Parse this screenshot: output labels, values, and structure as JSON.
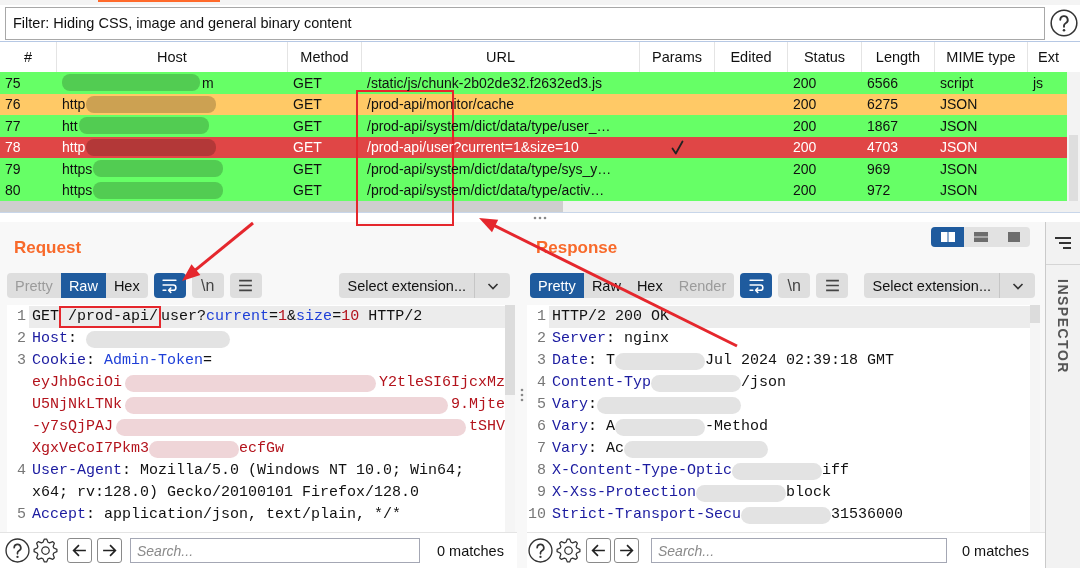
{
  "filter_bar": {
    "text": "Filter: Hiding CSS, image and general binary content"
  },
  "table": {
    "columns": [
      "#",
      "Host",
      "Method",
      "URL",
      "Params",
      "Edited",
      "Status",
      "Length",
      "MIME type",
      "Ext"
    ],
    "rows": [
      {
        "number": "75",
        "host": "m",
        "redacted_before": true,
        "redacted_after": false,
        "method": "GET",
        "url": "/static/js/chunk-2b02de32.f2632ed3.js",
        "params": false,
        "status": "200",
        "length": "6566",
        "mime": "script",
        "extension": "js",
        "color": "#66ff66"
      },
      {
        "number": "76",
        "host": "http",
        "redacted_before": false,
        "redacted_after": true,
        "method": "GET",
        "url": "/prod-api/monitor/cache",
        "params": false,
        "status": "200",
        "length": "6275",
        "mime": "JSON",
        "color": "#ffc966"
      },
      {
        "number": "77",
        "host": "htt",
        "redacted_before": false,
        "redacted_after": true,
        "method": "GET",
        "url": "/prod-api/system/dict/data/type/user_…",
        "params": false,
        "status": "200",
        "length": "1867",
        "mime": "JSON",
        "color": "#66ff66"
      },
      {
        "number": "78",
        "host": "http",
        "redacted_before": false,
        "redacted_after": true,
        "method": "GET",
        "url": "/prod-api/user?current=1&size=10",
        "params": true,
        "status": "200",
        "length": "4703",
        "mime": "JSON",
        "color": "#e04646"
      },
      {
        "number": "79",
        "host": "https",
        "redacted_before": false,
        "redacted_after": true,
        "method": "GET",
        "url": "/prod-api/system/dict/data/type/sys_y…",
        "params": false,
        "status": "200",
        "length": "969",
        "mime": "JSON",
        "color": "#66ff66"
      },
      {
        "number": "80",
        "host": "https",
        "redacted_before": false,
        "redacted_after": true,
        "method": "GET",
        "url": "/prod-api/system/dict/data/type/activ…",
        "params": false,
        "status": "200",
        "length": "972",
        "mime": "JSON",
        "color": "#66ff66"
      }
    ]
  },
  "request": {
    "title": "Request",
    "view_tabs": [
      {
        "label": "Pretty",
        "selected": false,
        "disabled": true
      },
      {
        "label": "Raw",
        "selected": true,
        "disabled": false
      },
      {
        "label": "Hex",
        "selected": false,
        "disabled": false
      }
    ],
    "tools": [
      {
        "kind": "wrap",
        "selected": true
      },
      {
        "kind": "newline",
        "label": "\\n",
        "selected": false
      },
      {
        "kind": "menu",
        "selected": false
      }
    ],
    "extension_select": "Select extension...",
    "lines": [
      {
        "number": "1",
        "current": true,
        "rows": [
          [
            {
              "kind": "plain",
              "text": "GET"
            },
            {
              "kind": "boxed",
              "text": "/prod-api/"
            },
            {
              "kind": "plain",
              "text": "user?"
            },
            {
              "kind": "param",
              "text": "current"
            },
            {
              "kind": "plain",
              "text": "="
            },
            {
              "kind": "value",
              "text": "1"
            },
            {
              "kind": "plain",
              "text": "&"
            },
            {
              "kind": "param",
              "text": "size"
            },
            {
              "kind": "plain",
              "text": "="
            },
            {
              "kind": "value",
              "text": "10"
            },
            {
              "kind": "plain",
              "text": " HTTP/2"
            }
          ]
        ]
      },
      {
        "number": "2",
        "current": false,
        "rows": [
          [
            {
              "kind": "name",
              "text": "Host"
            },
            {
              "kind": "plain",
              "text": ": "
            },
            {
              "kind": "blur"
            }
          ]
        ]
      },
      {
        "number": "3",
        "current": false,
        "rows": [
          [
            {
              "kind": "name",
              "text": "Cookie"
            },
            {
              "kind": "plain",
              "text": ": "
            },
            {
              "kind": "param",
              "text": "Admin-Token"
            },
            {
              "kind": "plain",
              "text": "="
            }
          ],
          [
            {
              "kind": "value",
              "text": "eyJhbGciOi"
            },
            {
              "kind": "blur"
            },
            {
              "kind": "value",
              "text": "Y2tleSI6IjcxMz"
            }
          ],
          [
            {
              "kind": "value",
              "text": "U5NjNkLTNk"
            },
            {
              "kind": "blur"
            },
            {
              "kind": "value",
              "text": "9.Mjte"
            }
          ],
          [
            {
              "kind": "value",
              "text": "-y7sQjPAJ"
            },
            {
              "kind": "blur"
            },
            {
              "kind": "value",
              "text": "tSHV"
            }
          ],
          [
            {
              "kind": "value",
              "text": "XgxVeCoI7Pkm3"
            },
            {
              "kind": "blur"
            },
            {
              "kind": "value",
              "text": "ecfGw"
            }
          ]
        ]
      },
      {
        "number": "4",
        "current": false,
        "rows": [
          [
            {
              "kind": "name",
              "text": "User-Agent"
            },
            {
              "kind": "plain",
              "text": ": Mozilla/5.0 (Windows NT 10.0; Win64;"
            }
          ],
          [
            {
              "kind": "plain",
              "text": "x64; rv:128.0) Gecko/20100101 Firefox/128.0"
            }
          ]
        ]
      },
      {
        "number": "5",
        "current": false,
        "rows": [
          [
            {
              "kind": "name",
              "text": "Accept"
            },
            {
              "kind": "plain",
              "text": ": application/json, text/plain, */*"
            }
          ]
        ]
      }
    ],
    "search": {
      "placeholder": "Search...",
      "matches": "0 matches"
    }
  },
  "response": {
    "title": "Response",
    "layout_buttons": [
      {
        "kind": "columns",
        "selected": true
      },
      {
        "kind": "rows",
        "selected": false
      },
      {
        "kind": "single",
        "selected": false
      }
    ],
    "view_tabs": [
      {
        "label": "Pretty",
        "selected": true,
        "disabled": false
      },
      {
        "label": "Raw",
        "selected": false,
        "disabled": false
      },
      {
        "label": "Hex",
        "selected": false,
        "disabled": false
      },
      {
        "label": "Render",
        "selected": false,
        "disabled": true
      }
    ],
    "tools": [
      {
        "kind": "wrap",
        "selected": true
      },
      {
        "kind": "newline",
        "label": "\\n",
        "selected": false
      },
      {
        "kind": "menu",
        "selected": false
      }
    ],
    "extension_select": "Select extension...",
    "lines": [
      {
        "number": "1",
        "current": true,
        "rows": [
          [
            {
              "kind": "plain",
              "text": "HTTP/2 200 OK"
            }
          ]
        ]
      },
      {
        "number": "2",
        "current": false,
        "rows": [
          [
            {
              "kind": "name",
              "text": "Server"
            },
            {
              "kind": "plain",
              "text": ": nginx"
            }
          ]
        ]
      },
      {
        "number": "3",
        "current": false,
        "rows": [
          [
            {
              "kind": "name",
              "text": "Date"
            },
            {
              "kind": "plain",
              "text": ": T"
            },
            {
              "kind": "blur"
            },
            {
              "kind": "plain",
              "text": "Jul 2024 02:39:18 GMT"
            }
          ]
        ]
      },
      {
        "number": "4",
        "current": false,
        "rows": [
          [
            {
              "kind": "name",
              "text": "Content-Typ"
            },
            {
              "kind": "blur"
            },
            {
              "kind": "plain",
              "text": "/json"
            }
          ]
        ]
      },
      {
        "number": "5",
        "current": false,
        "rows": [
          [
            {
              "kind": "name",
              "text": "Vary"
            },
            {
              "kind": "plain",
              "text": ":"
            },
            {
              "kind": "blur"
            }
          ]
        ]
      },
      {
        "number": "6",
        "current": false,
        "rows": [
          [
            {
              "kind": "name",
              "text": "Vary"
            },
            {
              "kind": "plain",
              "text": ": A"
            },
            {
              "kind": "blur"
            },
            {
              "kind": "plain",
              "text": "-Method"
            }
          ]
        ]
      },
      {
        "number": "7",
        "current": false,
        "rows": [
          [
            {
              "kind": "name",
              "text": "Vary"
            },
            {
              "kind": "plain",
              "text": ": Ac"
            },
            {
              "kind": "blur"
            }
          ]
        ]
      },
      {
        "number": "8",
        "current": false,
        "rows": [
          [
            {
              "kind": "name",
              "text": "X-Content-Type-Optic"
            },
            {
              "kind": "blur"
            },
            {
              "kind": "plain",
              "text": "iff"
            }
          ]
        ]
      },
      {
        "number": "9",
        "current": false,
        "rows": [
          [
            {
              "kind": "name",
              "text": "X-Xss-Protection"
            },
            {
              "kind": "blur"
            },
            {
              "kind": "plain",
              "text": "block"
            }
          ]
        ]
      },
      {
        "number": "10",
        "current": false,
        "rows": [
          [
            {
              "kind": "name",
              "text": "Strict-Transport-Secu"
            },
            {
              "kind": "blur"
            },
            {
              "kind": "plain",
              "text": "31536000"
            }
          ]
        ]
      }
    ],
    "search": {
      "placeholder": "Search...",
      "matches": "0 matches"
    }
  },
  "inspector": {
    "label": "INSPECTOR"
  }
}
